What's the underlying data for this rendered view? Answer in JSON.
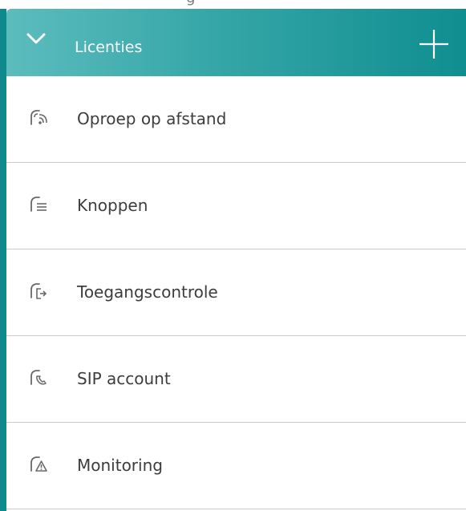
{
  "top_strip": {
    "text": "g"
  },
  "header": {
    "title": "Licenties",
    "add_icon": "plus-icon",
    "toggle_icon": "chevron-down-icon"
  },
  "items": [
    {
      "label": "Oproep op afstand",
      "icon": "remote-call-icon"
    },
    {
      "label": "Knoppen",
      "icon": "buttons-icon"
    },
    {
      "label": "Toegangscontrole",
      "icon": "access-control-icon"
    },
    {
      "label": "SIP account",
      "icon": "sip-phone-icon"
    },
    {
      "label": "Monitoring",
      "icon": "monitoring-warning-icon"
    }
  ],
  "colors": {
    "accent": "#0e8a8c",
    "header_gradient_start": "#5cbcbd",
    "header_gradient_end": "#0f8e90",
    "text": "#3d3d3d",
    "divider": "#c9c9c9"
  }
}
